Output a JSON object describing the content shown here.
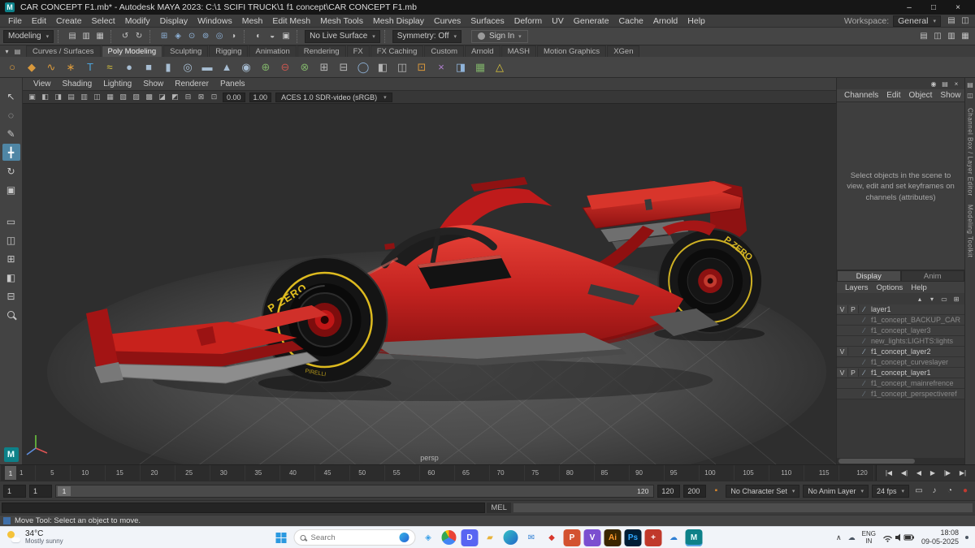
{
  "title_bar": {
    "title": "CAR CONCEPT F1.mb* - Autodesk MAYA 2023: C:\\1 SCIFI TRUCK\\1 f1 concept\\CAR CONCEPT F1.mb",
    "app_glyph": "M",
    "controls": [
      {
        "name": "minimize-button",
        "glyph": "–"
      },
      {
        "name": "maximize-button",
        "glyph": "□"
      },
      {
        "name": "close-button",
        "glyph": "×"
      }
    ]
  },
  "menu_bar": {
    "items": [
      "File",
      "Edit",
      "Create",
      "Select",
      "Modify",
      "Display",
      "Windows",
      "Mesh",
      "Edit Mesh",
      "Mesh Tools",
      "Mesh Display",
      "Curves",
      "Surfaces",
      "Deform",
      "UV",
      "Generate",
      "Cache",
      "Arnold",
      "Help"
    ],
    "workspace_label": "Workspace:",
    "workspace_value": "General",
    "right_icons": [
      {
        "name": "workspace-save-icon",
        "glyph": "▤"
      },
      {
        "name": "workspace-reset-icon",
        "glyph": "◫"
      }
    ]
  },
  "status_line": {
    "mode": "Modeling",
    "file_icons": [
      {
        "name": "new-scene-icon",
        "glyph": "▤"
      },
      {
        "name": "open-scene-icon",
        "glyph": "▥"
      },
      {
        "name": "save-scene-icon",
        "glyph": "▦"
      }
    ],
    "edit_icons": [
      {
        "name": "undo-icon",
        "glyph": "↺"
      },
      {
        "name": "redo-icon",
        "glyph": "↻"
      }
    ],
    "snap_icons": [
      {
        "name": "snap-to-grid-icon",
        "glyph": "⊞",
        "fg": "#8fb3d9"
      },
      {
        "name": "snap-to-curve-icon",
        "glyph": "◈",
        "fg": "#8fb3d9"
      },
      {
        "name": "snap-to-point-icon",
        "glyph": "⊙",
        "fg": "#8fb3d9"
      },
      {
        "name": "snap-to-projected-center-icon",
        "glyph": "⊚",
        "fg": "#8fb3d9"
      },
      {
        "name": "make-live-icon",
        "glyph": "◎",
        "fg": "#8fb3d9"
      },
      {
        "name": "construction-history-icon",
        "glyph": "◑"
      }
    ],
    "render_icons": [
      {
        "name": "render-current-frame-icon",
        "glyph": "◐"
      },
      {
        "name": "ipr-render-icon",
        "glyph": "◒"
      },
      {
        "name": "render-settings-icon",
        "glyph": "▣"
      }
    ],
    "live_surface": "No Live Surface",
    "symmetry": "Symmetry: Off",
    "sign_in": "Sign In",
    "far_icons": [
      {
        "name": "outliner-toggle-icon",
        "glyph": "▤"
      },
      {
        "name": "channel-box-toggle-icon",
        "glyph": "◫"
      },
      {
        "name": "attribute-editor-toggle-icon",
        "glyph": "▥"
      },
      {
        "name": "tool-settings-toggle-icon",
        "glyph": "▦"
      }
    ]
  },
  "shelf": {
    "left_icons": [
      {
        "name": "shelf-menu-icon",
        "glyph": "▾"
      },
      {
        "name": "shelf-gear-icon",
        "glyph": "▤"
      }
    ],
    "tabs": [
      {
        "label": "Curves / Surfaces"
      },
      {
        "label": "Poly Modeling",
        "cls": "active"
      },
      {
        "label": "Sculpting"
      },
      {
        "label": "Rigging"
      },
      {
        "label": "Animation"
      },
      {
        "label": "Rendering"
      },
      {
        "label": "FX"
      },
      {
        "label": "FX Caching"
      },
      {
        "label": "Custom"
      },
      {
        "label": "Arnold"
      },
      {
        "label": "MASH"
      },
      {
        "label": "Motion Graphics"
      },
      {
        "label": "XGen"
      }
    ],
    "icons": [
      {
        "name": "nurbs-circle-icon",
        "glyph": "○",
        "fg": "#d9993c"
      },
      {
        "name": "bezier-curve-icon",
        "glyph": "◆",
        "fg": "#d9993c"
      },
      {
        "name": "ep-curve-icon",
        "glyph": "∿",
        "fg": "#d9993c"
      },
      {
        "name": "star-curve-icon",
        "glyph": "∗",
        "fg": "#d9993c"
      },
      {
        "name": "type-tool-icon",
        "glyph": "T",
        "fg": "#4da3d9"
      },
      {
        "name": "sweep-mesh-icon",
        "glyph": "≈",
        "fg": "#d9c43c"
      },
      {
        "name": "poly-sphere-icon",
        "glyph": "●",
        "fg": "#a7bdd2"
      },
      {
        "name": "poly-cube-icon",
        "glyph": "■",
        "fg": "#a7bdd2"
      },
      {
        "name": "poly-cylinder-icon",
        "glyph": "▮",
        "fg": "#a7bdd2"
      },
      {
        "name": "poly-torus-icon",
        "glyph": "◎",
        "fg": "#a7bdd2"
      },
      {
        "name": "poly-plane-icon",
        "glyph": "▬",
        "fg": "#a7bdd2"
      },
      {
        "name": "poly-cone-icon",
        "glyph": "▲",
        "fg": "#a7bdd2"
      },
      {
        "name": "poly-disc-icon",
        "glyph": "◉",
        "fg": "#a7bdd2"
      },
      {
        "name": "boolean-union-icon",
        "glyph": "⊕",
        "fg": "#7fb069"
      },
      {
        "name": "boolean-difference-icon",
        "glyph": "⊖",
        "fg": "#c4564f"
      },
      {
        "name": "boolean-intersection-icon",
        "glyph": "⊗",
        "fg": "#7fb069"
      },
      {
        "name": "combine-icon",
        "glyph": "⊞",
        "fg": "#b5b5b5"
      },
      {
        "name": "separate-icon",
        "glyph": "⊟",
        "fg": "#b5b5b5"
      },
      {
        "name": "smooth-mesh-icon",
        "glyph": "◯",
        "fg": "#8fb3d9"
      },
      {
        "name": "bevel-icon",
        "glyph": "◧",
        "fg": "#b5b5b5"
      },
      {
        "name": "bridge-icon",
        "glyph": "◫",
        "fg": "#b5b5b5"
      },
      {
        "name": "extrude-icon",
        "glyph": "⊡",
        "fg": "#d9993c"
      },
      {
        "name": "multi-cut-icon",
        "glyph": "×",
        "fg": "#b07fd0"
      },
      {
        "name": "mirror-icon",
        "glyph": "◨",
        "fg": "#8fb3d9"
      },
      {
        "name": "quad-draw-icon",
        "glyph": "▦",
        "fg": "#7fb069"
      },
      {
        "name": "target-weld-icon",
        "glyph": "△",
        "fg": "#d9c43c"
      }
    ]
  },
  "toolbox": {
    "tools": [
      {
        "name": "select-tool-icon",
        "glyph": "↖"
      },
      {
        "name": "lasso-tool-icon",
        "glyph": "◌"
      },
      {
        "name": "paint-select-tool-icon",
        "glyph": "✎"
      },
      {
        "name": "move-tool-icon",
        "glyph": "╋",
        "cls": "active"
      },
      {
        "name": "rotate-tool-icon",
        "glyph": "↻"
      },
      {
        "name": "scale-tool-icon",
        "glyph": "▣"
      }
    ],
    "layouts": [
      {
        "name": "single-pane-layout-icon",
        "glyph": "▭"
      },
      {
        "name": "two-pane-layout-icon",
        "glyph": "◫"
      },
      {
        "name": "four-pane-layout-icon",
        "glyph": "⊞"
      },
      {
        "name": "outliner-pane-layout-icon",
        "glyph": "◧"
      },
      {
        "name": "split-pane-layout-icon",
        "glyph": "⊟"
      }
    ],
    "home_glyph": "M"
  },
  "viewport": {
    "menus": [
      "View",
      "Shading",
      "Lighting",
      "Show",
      "Renderer",
      "Panels"
    ],
    "toolbar_icons": [
      {
        "name": "select-camera-icon",
        "glyph": "▣"
      },
      {
        "name": "lock-camera-icon",
        "glyph": "◧"
      },
      {
        "name": "camera-attributes-icon",
        "glyph": "◨"
      },
      {
        "name": "bookmarks-icon",
        "glyph": "▤"
      },
      {
        "name": "image-plane-icon",
        "glyph": "▥"
      },
      {
        "name": "two-d-pan-zoom-icon",
        "glyph": "◫"
      },
      {
        "name": "oversampling-icon",
        "glyph": "▦"
      },
      {
        "name": "wireframe-icon",
        "glyph": "▧"
      },
      {
        "name": "shaded-icon",
        "glyph": "▨"
      },
      {
        "name": "textured-icon",
        "glyph": "▩"
      },
      {
        "name": "use-all-lights-icon",
        "glyph": "◪"
      },
      {
        "name": "shadows-icon",
        "glyph": "◩"
      },
      {
        "name": "screen-space-ao-icon",
        "glyph": "⊟"
      },
      {
        "name": "motion-blur-icon",
        "glyph": "⊠"
      },
      {
        "name": "isolate-select-icon",
        "glyph": "⊡"
      }
    ],
    "exposure": "0.00",
    "gamma": "1.00",
    "colorspace": "ACES 1.0 SDR-video (sRGB)",
    "camera_label": "persp",
    "scene": {
      "car_red": "#c42320",
      "tire_brand_yellow": "#ddba1f",
      "tire_text_front": "P ZERO",
      "tire_text_front_small": "PIRELLI",
      "tire_text_rear": "P ZERO",
      "background": "#2e2e2e",
      "floor": "#555555"
    }
  },
  "channel_box": {
    "top_icons": [
      {
        "name": "pin-panel-icon",
        "glyph": "◉"
      },
      {
        "name": "panel-options-icon",
        "glyph": "▤"
      },
      {
        "name": "collapse-panel-icon",
        "glyph": "×"
      }
    ],
    "menus": [
      "Channels",
      "Edit",
      "Object",
      "Show"
    ],
    "message": "Select objects in the scene to view, edit and set keyframes on channels (attributes)"
  },
  "layer_editor": {
    "tabs": [
      {
        "label": "Display",
        "cls": "active"
      },
      {
        "label": "Anim"
      }
    ],
    "menus": [
      "Layers",
      "Options",
      "Help"
    ],
    "toolbar_icons": [
      {
        "name": "move-layer-up-icon",
        "glyph": "▴"
      },
      {
        "name": "move-layer-down-icon",
        "glyph": "▾"
      },
      {
        "name": "empty-layer-icon",
        "glyph": "▭"
      },
      {
        "name": "new-layer-icon",
        "glyph": "⊞"
      }
    ],
    "layers": [
      {
        "v": "V",
        "p": "P",
        "name": "layer1",
        "state": "visible"
      },
      {
        "v": "",
        "p": "",
        "name": "f1_concept_BACKUP_CAR",
        "state": "hidden"
      },
      {
        "v": "",
        "p": "",
        "name": "f1_concept_layer3",
        "state": "hidden"
      },
      {
        "v": "",
        "p": "",
        "name": "new_lights:LIGHTS:lights",
        "state": "hidden"
      },
      {
        "v": "V",
        "p": "",
        "name": "f1_concept_layer2",
        "state": "visible"
      },
      {
        "v": "",
        "p": "",
        "name": "f1_concept_curveslayer",
        "state": "hidden"
      },
      {
        "v": "V",
        "p": "P",
        "name": "f1_concept_layer1",
        "state": "visible"
      },
      {
        "v": "",
        "p": "",
        "name": "f1_concept_mainrefrence",
        "state": "hidden"
      },
      {
        "v": "",
        "p": "",
        "name": "f1_concept_perspectiveref",
        "state": "hidden"
      }
    ]
  },
  "sidebar_right": {
    "icons": [
      {
        "name": "attribute-editor-tab-icon",
        "glyph": "▤"
      },
      {
        "name": "tool-settings-tab-icon",
        "glyph": "◫"
      }
    ],
    "labels": [
      "Channel Box / Layer Editor",
      "Modeling Toolkit"
    ]
  },
  "timeline": {
    "current_frame": "1",
    "ticks": [
      "1",
      "5",
      "10",
      "15",
      "20",
      "25",
      "30",
      "35",
      "40",
      "45",
      "50",
      "55",
      "60",
      "65",
      "70",
      "75",
      "80",
      "85",
      "90",
      "95",
      "100",
      "105",
      "110",
      "115",
      "120"
    ],
    "playback": [
      {
        "name": "go-to-start-button",
        "glyph": "|◀"
      },
      {
        "name": "step-back-frame-button",
        "glyph": "◀|"
      },
      {
        "name": "play-backwards-button",
        "glyph": "◀"
      },
      {
        "name": "play-forwards-button",
        "glyph": "▶"
      },
      {
        "name": "step-forward-frame-button",
        "glyph": "|▶"
      },
      {
        "name": "go-to-end-button",
        "glyph": "▶|"
      }
    ]
  },
  "range_slider": {
    "playback_start": "1",
    "current_min": "1",
    "slider_start": "1",
    "slider_end": "120",
    "playback_end": "120",
    "animation_end": "200",
    "key_icons": [
      {
        "name": "character-set-key-icon",
        "glyph": "▪",
        "fg": "#d8862c"
      }
    ],
    "character_set": "No Character Set",
    "anim_layer": "No Anim Layer",
    "fps": "24 fps",
    "right_icons": [
      {
        "name": "playback-options-icon",
        "glyph": "▭"
      },
      {
        "name": "mute-audio-icon",
        "glyph": "♪"
      },
      {
        "name": "playback-speed-icon",
        "glyph": "◔"
      },
      {
        "name": "auto-keyframe-icon",
        "glyph": "●",
        "fg": "#c23a30"
      }
    ]
  },
  "command_line": {
    "mel_label": "MEL"
  },
  "help_line": {
    "text": "Move Tool: Select an object to move."
  },
  "taskbar": {
    "weather": {
      "temp": "34°C",
      "desc": "Mostly sunny"
    },
    "search": {
      "placeholder": "Search"
    },
    "apps": [
      {
        "name": "paint-3d-icon",
        "glyph": "◈",
        "fg": "#3aa0e8"
      },
      {
        "name": "chrome-icon",
        "glyph": "",
        "color": "conic-gradient(from 0deg, #ea4335 0deg 120deg, #4285f4 120deg 240deg, #34a853 240deg 330deg, #fbbc05 330deg 360deg)",
        "cls": "round"
      },
      {
        "name": "discord-icon",
        "glyph": "D",
        "color": "#5865f2",
        "fg": "#ffffff"
      },
      {
        "name": "folder-icon",
        "glyph": "▰",
        "fg": "#e8b33a"
      },
      {
        "name": "edge-icon",
        "glyph": "",
        "color": "linear-gradient(135deg,#35c2c5,#2266c9)",
        "cls": "round"
      },
      {
        "name": "mail-icon",
        "glyph": "✉",
        "fg": "#2f7fd4"
      },
      {
        "name": "sketchbook-icon",
        "glyph": "◆",
        "fg": "#d8372c"
      },
      {
        "name": "powerpoint-icon",
        "glyph": "P",
        "color": "#d35230",
        "fg": "#ffffff"
      },
      {
        "name": "app-violet-icon",
        "glyph": "V",
        "color": "#7b4fd0",
        "fg": "#ffffff"
      },
      {
        "name": "illustrator-icon",
        "glyph": "Ai",
        "color": "#3a2600",
        "fg": "#ff9a2e"
      },
      {
        "name": "photoshop-icon",
        "glyph": "Ps",
        "color": "#001e36",
        "fg": "#31a8ff"
      },
      {
        "name": "defender-icon",
        "glyph": "+",
        "color": "#c0392b",
        "fg": "#ffffff"
      },
      {
        "name": "onedrive-icon",
        "glyph": "☁",
        "fg": "#2f7fd4"
      },
      {
        "name": "maya-icon",
        "glyph": "M",
        "color": "#0d8189",
        "fg": "#eaffff",
        "cls": "active"
      }
    ],
    "tray": {
      "chevron": "∧",
      "cloud": "☁",
      "lang_line1": "ENG",
      "lang_line2": "IN",
      "time": "18:08",
      "date": "09-05-2025"
    }
  }
}
